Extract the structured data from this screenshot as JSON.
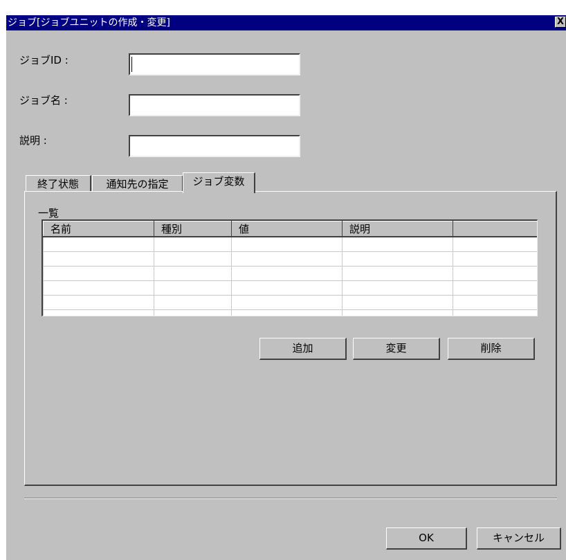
{
  "window": {
    "title": "ジョブ[ジョブユニットの作成・変更]",
    "close_label": "X"
  },
  "form": {
    "job_id_label": "ジョブID :",
    "job_id_value": "",
    "job_name_label": "ジョブ名 :",
    "job_name_value": "",
    "description_label": "説明 :",
    "description_value": ""
  },
  "tabs": [
    {
      "label": "終了状態",
      "active": false
    },
    {
      "label": "通知先の指定",
      "active": false
    },
    {
      "label": "ジョブ変数",
      "active": true
    }
  ],
  "variables": {
    "list_label": "一覧",
    "columns": [
      "名前",
      "種別",
      "値",
      "説明",
      ""
    ],
    "row_count": 6,
    "add_label": "追加",
    "modify_label": "変更",
    "delete_label": "削除"
  },
  "footer": {
    "ok_label": "OK",
    "cancel_label": "キャンセル"
  }
}
